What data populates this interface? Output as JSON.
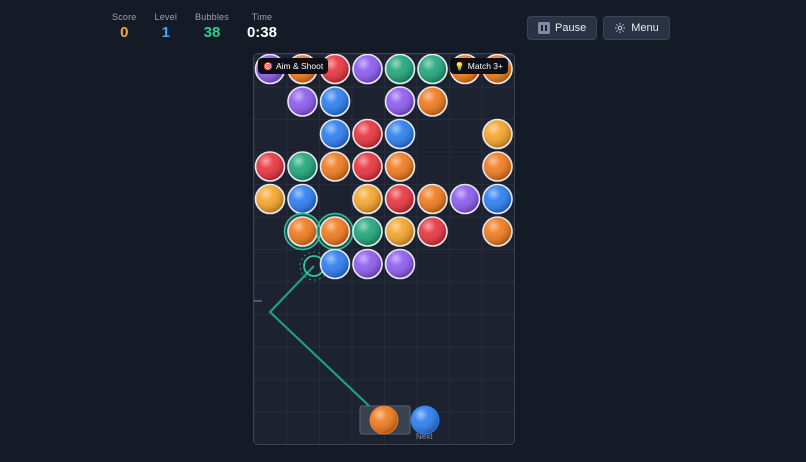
{
  "hud": {
    "stats": [
      {
        "label": "Score",
        "value": "0",
        "color": "#f2a93b"
      },
      {
        "label": "Level",
        "value": "1",
        "color": "#3ea7ff"
      },
      {
        "label": "Bubbles",
        "value": "38",
        "color": "#2ecf86"
      },
      {
        "label": "Time",
        "value": "0:38",
        "color": "#ffffff"
      }
    ]
  },
  "buttons": {
    "pause": {
      "label": "Pause",
      "icon": "pause-icon"
    },
    "menu": {
      "label": "Menu",
      "icon": "gear-icon"
    }
  },
  "board": {
    "tag_left": {
      "label": "Aim & Shoot",
      "icon": "target-icon"
    },
    "tag_right": {
      "label": "Match 3+",
      "icon": "lightbulb-icon"
    },
    "next_label": "Next",
    "colors": {
      "purple": "#8d5bf0",
      "orange": "#f07a1e",
      "red": "#e8343e",
      "green": "#1fa67a",
      "blue": "#2b7ef0",
      "yellow": "#f5a52a"
    },
    "bubbles": [
      {
        "row": 0,
        "col": 0,
        "color": "purple"
      },
      {
        "row": 0,
        "col": 1,
        "color": "orange"
      },
      {
        "row": 0,
        "col": 2,
        "color": "red"
      },
      {
        "row": 0,
        "col": 3,
        "color": "purple"
      },
      {
        "row": 0,
        "col": 4,
        "color": "green"
      },
      {
        "row": 0,
        "col": 5,
        "color": "green"
      },
      {
        "row": 0,
        "col": 6,
        "color": "orange"
      },
      {
        "row": 0,
        "col": 7,
        "color": "orange"
      },
      {
        "row": 1,
        "col": 1,
        "color": "purple"
      },
      {
        "row": 1,
        "col": 2,
        "color": "blue"
      },
      {
        "row": 1,
        "col": 4,
        "color": "purple"
      },
      {
        "row": 1,
        "col": 5,
        "color": "orange"
      },
      {
        "row": 2,
        "col": 2,
        "color": "blue"
      },
      {
        "row": 2,
        "col": 3,
        "color": "red"
      },
      {
        "row": 2,
        "col": 4,
        "color": "blue"
      },
      {
        "row": 2,
        "col": 7,
        "color": "yellow"
      },
      {
        "row": 3,
        "col": 0,
        "color": "red"
      },
      {
        "row": 3,
        "col": 1,
        "color": "green"
      },
      {
        "row": 3,
        "col": 2,
        "color": "orange"
      },
      {
        "row": 3,
        "col": 3,
        "color": "red"
      },
      {
        "row": 3,
        "col": 4,
        "color": "orange"
      },
      {
        "row": 3,
        "col": 7,
        "color": "orange"
      },
      {
        "row": 4,
        "col": 0,
        "color": "yellow"
      },
      {
        "row": 4,
        "col": 1,
        "color": "blue"
      },
      {
        "row": 4,
        "col": 3,
        "color": "yellow"
      },
      {
        "row": 4,
        "col": 4,
        "color": "red"
      },
      {
        "row": 4,
        "col": 5,
        "color": "orange"
      },
      {
        "row": 4,
        "col": 6,
        "color": "purple"
      },
      {
        "row": 4,
        "col": 7,
        "color": "blue"
      },
      {
        "row": 5,
        "col": 1,
        "color": "orange",
        "highlight": true
      },
      {
        "row": 5,
        "col": 2,
        "color": "orange",
        "highlight": true
      },
      {
        "row": 5,
        "col": 3,
        "color": "green"
      },
      {
        "row": 5,
        "col": 4,
        "color": "yellow"
      },
      {
        "row": 5,
        "col": 5,
        "color": "red"
      },
      {
        "row": 5,
        "col": 7,
        "color": "orange"
      },
      {
        "row": 6,
        "col": 2,
        "color": "blue"
      },
      {
        "row": 6,
        "col": 3,
        "color": "purple"
      },
      {
        "row": 6,
        "col": 4,
        "color": "purple"
      }
    ],
    "current_shot": "orange",
    "next_bubble": "blue"
  }
}
